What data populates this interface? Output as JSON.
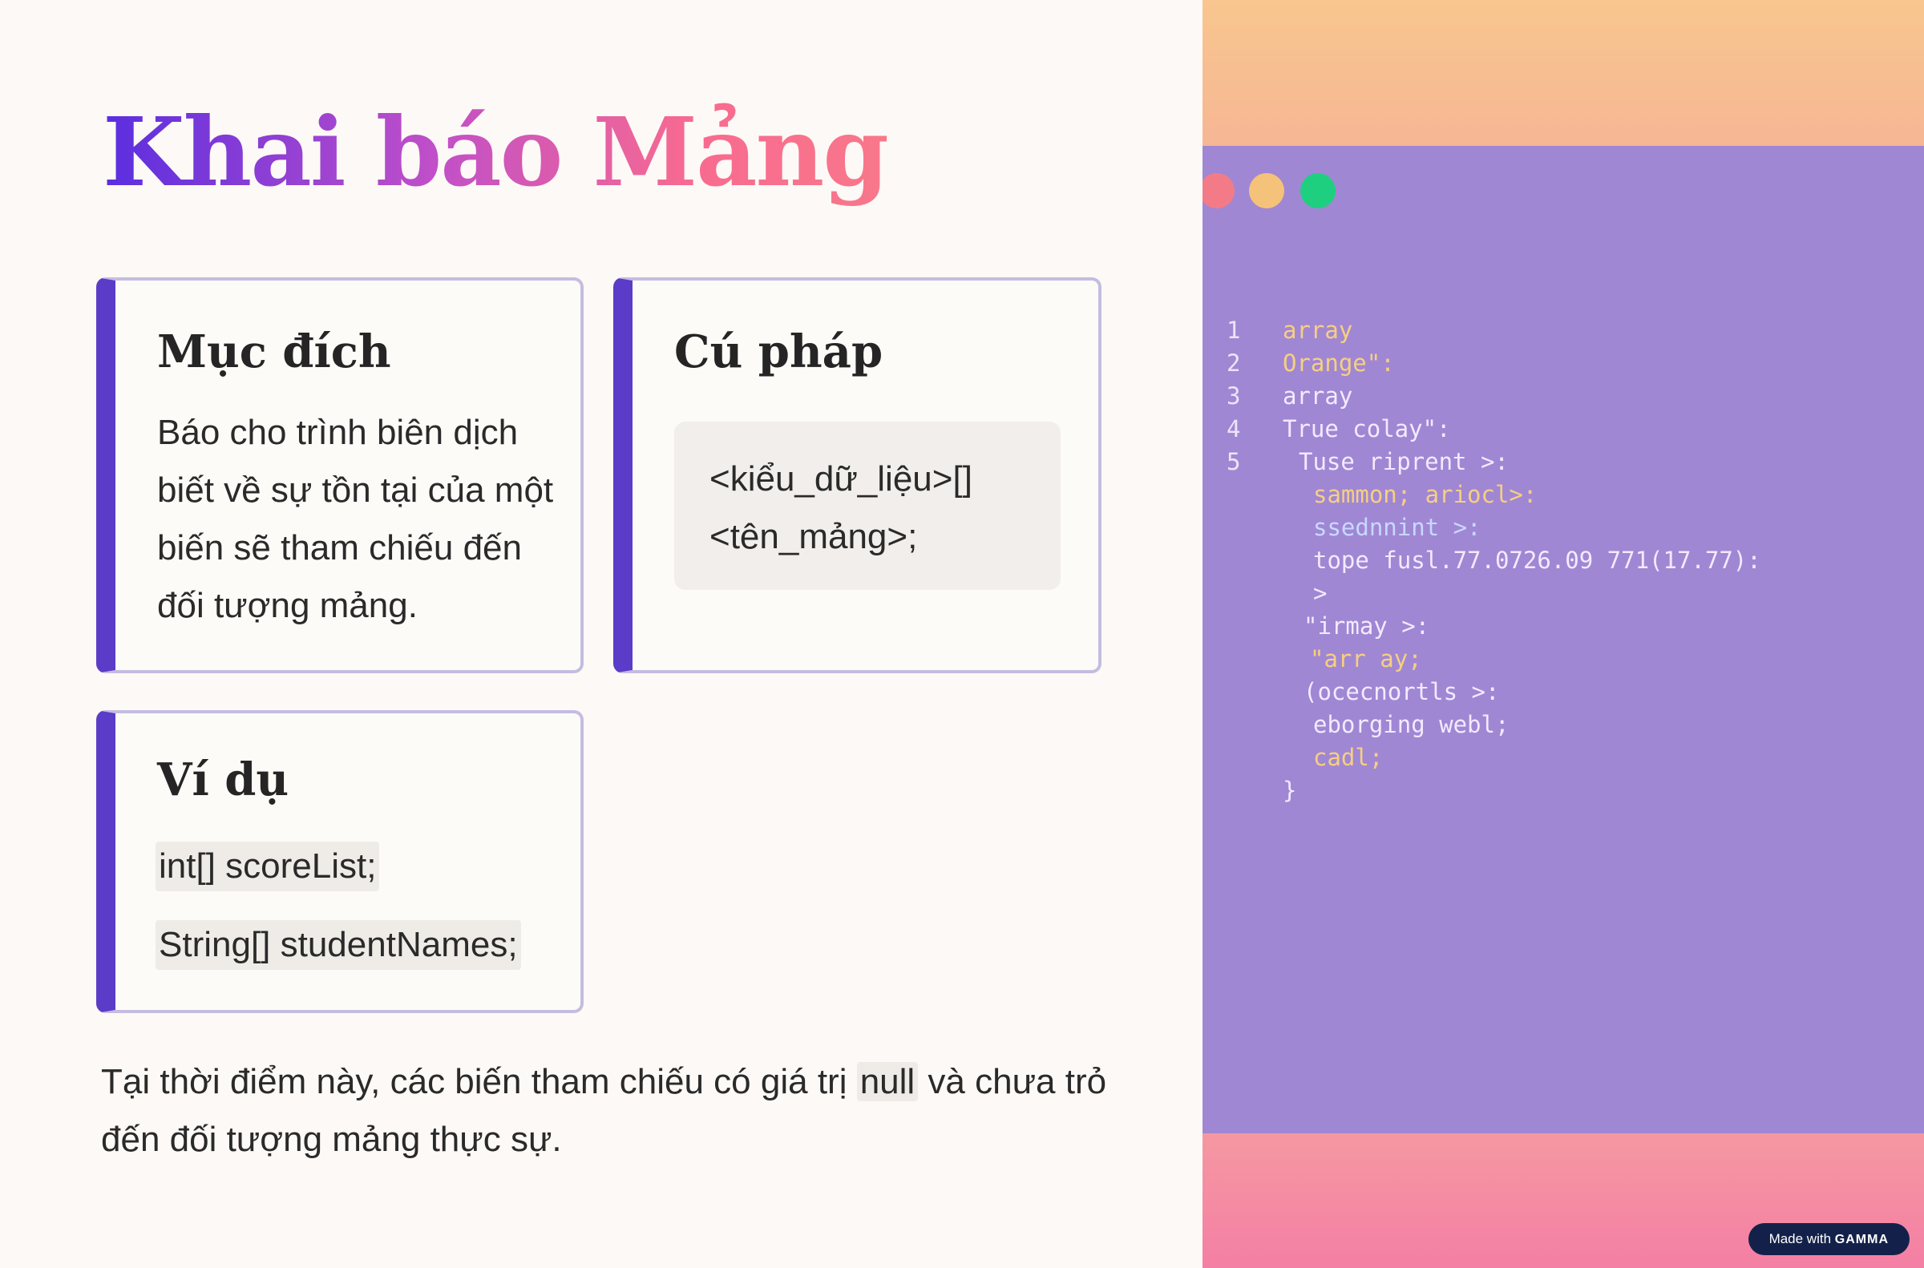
{
  "slide": {
    "title": "Khai báo Mảng",
    "purpose": {
      "heading": "Mục đích",
      "body": "Báo cho trình biên dịch biết về sự tồn tại của một biến sẽ tham chiếu đến đối tượng mảng."
    },
    "syntax": {
      "heading": "Cú pháp",
      "code_line1": "<kiểu_dữ_liệu>[]",
      "code_line2": "<tên_mảng>;"
    },
    "example": {
      "heading": "Ví dụ",
      "line1": "int[] scoreList;",
      "line2": "String[] studentNames;"
    },
    "note": {
      "before": "Tại thời điểm này, các biến tham chiếu có giá trị ",
      "code": "null",
      "after": " và chưa trỏ đến đối tượng mảng thực sự."
    }
  },
  "code_window": {
    "lines": [
      {
        "num": "1",
        "text": "array"
      },
      {
        "num": "2",
        "text": "Orange\":"
      },
      {
        "num": "3",
        "text": "array"
      },
      {
        "num": "4",
        "text": "True colay\":"
      },
      {
        "num": "5",
        "text": "Tuse riprent >:"
      },
      {
        "num": "",
        "text": "sammon; ariocl>:"
      },
      {
        "num": "",
        "text": "ssednnint >:"
      },
      {
        "num": "",
        "text": "tope fusl.77.0726.09 771(17.77):"
      },
      {
        "num": "",
        "text": ">"
      },
      {
        "num": "",
        "text": "\"irmay >:"
      },
      {
        "num": "",
        "text": "\"arr ay;"
      },
      {
        "num": "",
        "text": "(ocecnortls >:"
      },
      {
        "num": "",
        "text": "eborging webl;"
      },
      {
        "num": "",
        "text": "cadl;"
      },
      {
        "num": "",
        "text": "}"
      }
    ]
  },
  "badge": {
    "prefix": "Made with",
    "brand": "GAMMA"
  },
  "colors": {
    "accent": "#5b3cc8",
    "card_border": "#c4bde0",
    "editor_bg": "#a087d3",
    "title_gradient_start": "#5a2ee0",
    "title_gradient_end": "#f8788a"
  }
}
